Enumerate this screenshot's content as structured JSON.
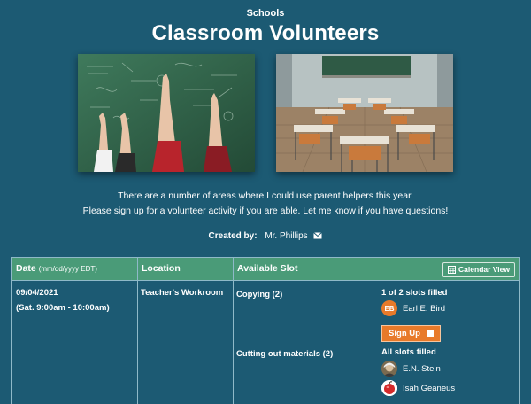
{
  "header": {
    "category": "Schools",
    "title": "Classroom Volunteers"
  },
  "description": {
    "line1": "There are a number of areas where I could use parent helpers this year.",
    "line2": "Please sign up for a volunteer activity if you are able. Let me know if you have questions!"
  },
  "creator": {
    "label": "Created by:",
    "name": "Mr. Phillips"
  },
  "table": {
    "col_date": "Date",
    "col_date_hint": "(mm/dd/yyyy EDT)",
    "col_location": "Location",
    "col_slot": "Available Slot",
    "calendar_view": "Calendar View",
    "rows": [
      {
        "date": "09/04/2021",
        "time": "(Sat. 9:00am - 10:00am)",
        "location": "Teacher's Workroom",
        "slots": [
          {
            "name": "Copying (2)",
            "status": "1 of 2 slots filled",
            "volunteers": [
              {
                "initials": "EB",
                "name": "Earl E. Bird"
              }
            ],
            "signup_label": "Sign Up"
          },
          {
            "name": "Cutting out materials (2)",
            "status": "All slots filled",
            "volunteers": [
              {
                "name": "E.N. Stein"
              },
              {
                "name": "Isah Geaneus"
              }
            ]
          }
        ]
      }
    ]
  },
  "colors": {
    "background": "#1c5a73",
    "header": "#4a9b78",
    "accent": "#e87a2a"
  }
}
